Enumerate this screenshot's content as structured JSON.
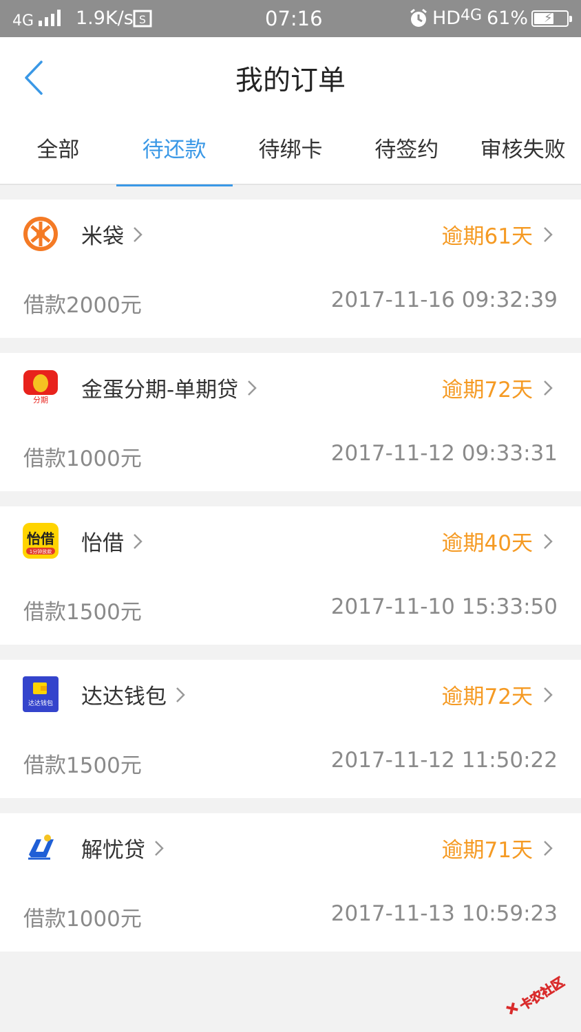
{
  "status_bar": {
    "network": "4G",
    "speed": "1.9K/s",
    "time": "07:16",
    "hd": "HD",
    "network2": "4G",
    "battery": "61%",
    "battery_level": 0.61
  },
  "header": {
    "title": "我的订单",
    "back_icon": "chevron-left-icon"
  },
  "tabs": [
    {
      "label": "全部"
    },
    {
      "label": "待还款",
      "active": true
    },
    {
      "label": "待绑卡"
    },
    {
      "label": "待签约"
    },
    {
      "label": "审核失败"
    }
  ],
  "orders": [
    {
      "name": "米袋",
      "status": "逾期61天",
      "amount": "借款2000元",
      "date": "2017-11-16 09:32:39"
    },
    {
      "name": "金蛋分期-单期贷",
      "status": "逾期72天",
      "amount": "借款1000元",
      "date": "2017-11-12 09:33:31",
      "logo_text": "分期"
    },
    {
      "name": "怡借",
      "status": "逾期40天",
      "amount": "借款1500元",
      "date": "2017-11-10 15:33:50",
      "logo_text": "怡借",
      "logo_sub": "1分钟放款"
    },
    {
      "name": "达达钱包",
      "status": "逾期72天",
      "amount": "借款1500元",
      "date": "2017-11-12 11:50:22",
      "logo_text": "达达钱包"
    },
    {
      "name": "解忧贷",
      "status": "逾期71天",
      "amount": "借款1000元",
      "date": "2017-11-13 10:59:23"
    }
  ],
  "watermark": "卡农社区",
  "colors": {
    "accent": "#3a98e6",
    "overdue": "#f59a23",
    "status_bar": "#8e8e8e"
  }
}
